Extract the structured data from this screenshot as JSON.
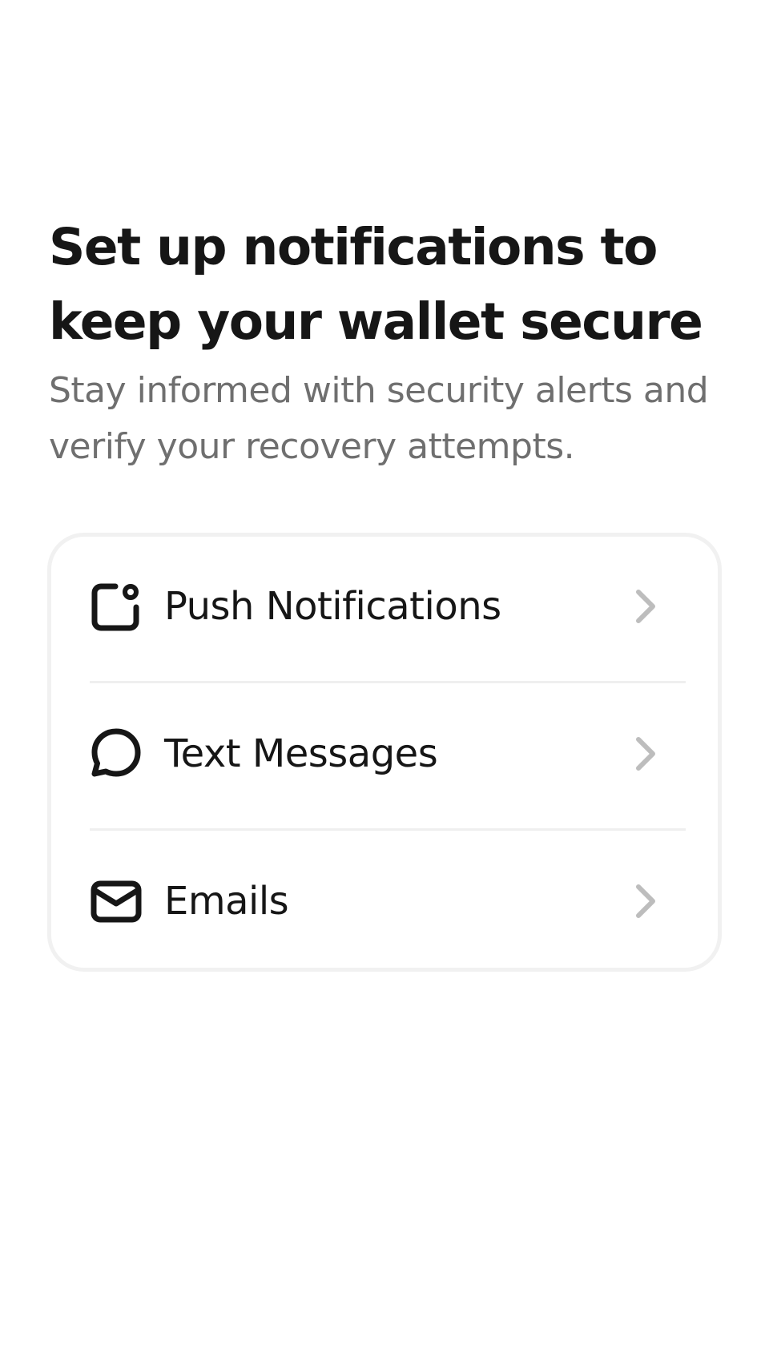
{
  "header": {
    "title": "Set up notifications to keep your wallet secure",
    "subtitle": "Stay informed with security alerts and verify your recovery attempts."
  },
  "options": [
    {
      "label": "Push Notifications",
      "icon": "notification-badge-icon"
    },
    {
      "label": "Text Messages",
      "icon": "chat-bubble-icon"
    },
    {
      "label": "Emails",
      "icon": "envelope-icon"
    }
  ],
  "colors": {
    "title": "#161616",
    "subtitle": "#6f6f6f",
    "card_border": "#f1f1f1",
    "chevron": "#bdbdbd"
  }
}
